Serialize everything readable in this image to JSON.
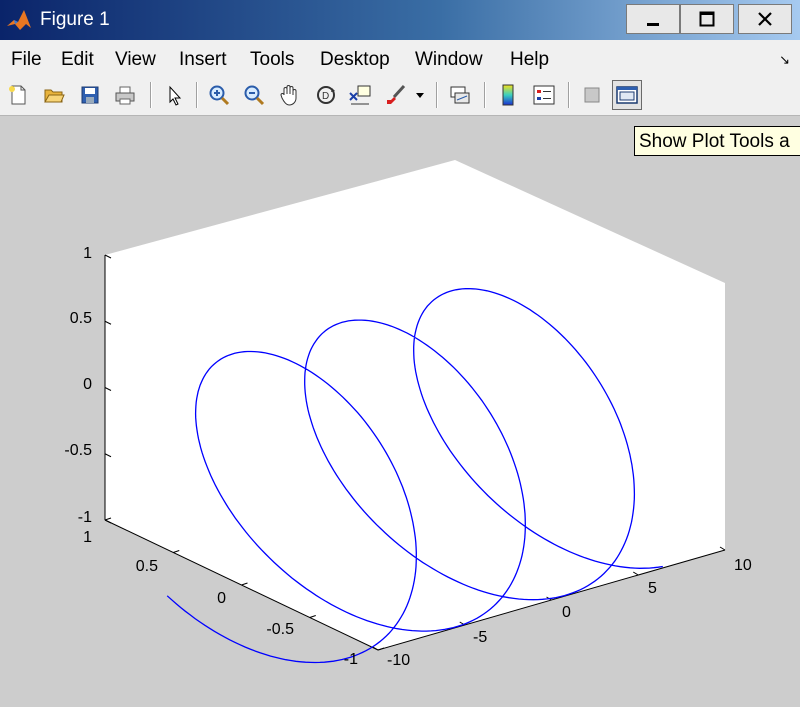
{
  "window": {
    "title": "Figure 1",
    "buttons": {
      "minimize": "—",
      "maximize": "☐",
      "close": "✕"
    }
  },
  "menu": [
    "File",
    "Edit",
    "View",
    "Insert",
    "Tools",
    "Desktop",
    "Window",
    "Help"
  ],
  "toolbar": {
    "icons": [
      "new-figure-icon",
      "open-file-icon",
      "save-icon",
      "print-icon",
      "select-arrow-icon",
      "zoom-in-icon",
      "zoom-out-icon",
      "pan-hand-icon",
      "rotate-3d-icon",
      "data-cursor-icon",
      "brush-icon",
      "brush-dropdown-icon",
      "link-plot-icon",
      "colorbar-icon",
      "legend-icon",
      "hide-plot-tools-icon",
      "show-plot-tools-icon"
    ]
  },
  "tooltip": {
    "text": "Show Plot Tools a"
  },
  "chart_data": {
    "type": "line",
    "projection": "3d",
    "series": [
      {
        "color": "#0000ff",
        "description": "helix x=t, y=sin(t), z=cos(t)",
        "x_range": [
          -10,
          10
        ]
      }
    ],
    "xlim": [
      -10,
      10
    ],
    "ylim": [
      -1,
      1
    ],
    "zlim": [
      -1,
      1
    ],
    "x_ticks": [
      "-10",
      "-5",
      "0",
      "5",
      "10"
    ],
    "y_ticks": [
      "-1",
      "-0.5",
      "0",
      "0.5",
      "1"
    ],
    "z_ticks": [
      "-1",
      "-0.5",
      "0",
      "0.5",
      "1"
    ],
    "grid": false
  },
  "colors": {
    "plot_bg": "#ffffff",
    "figure_bg": "#cdcdcd",
    "line": "#0000ff"
  }
}
